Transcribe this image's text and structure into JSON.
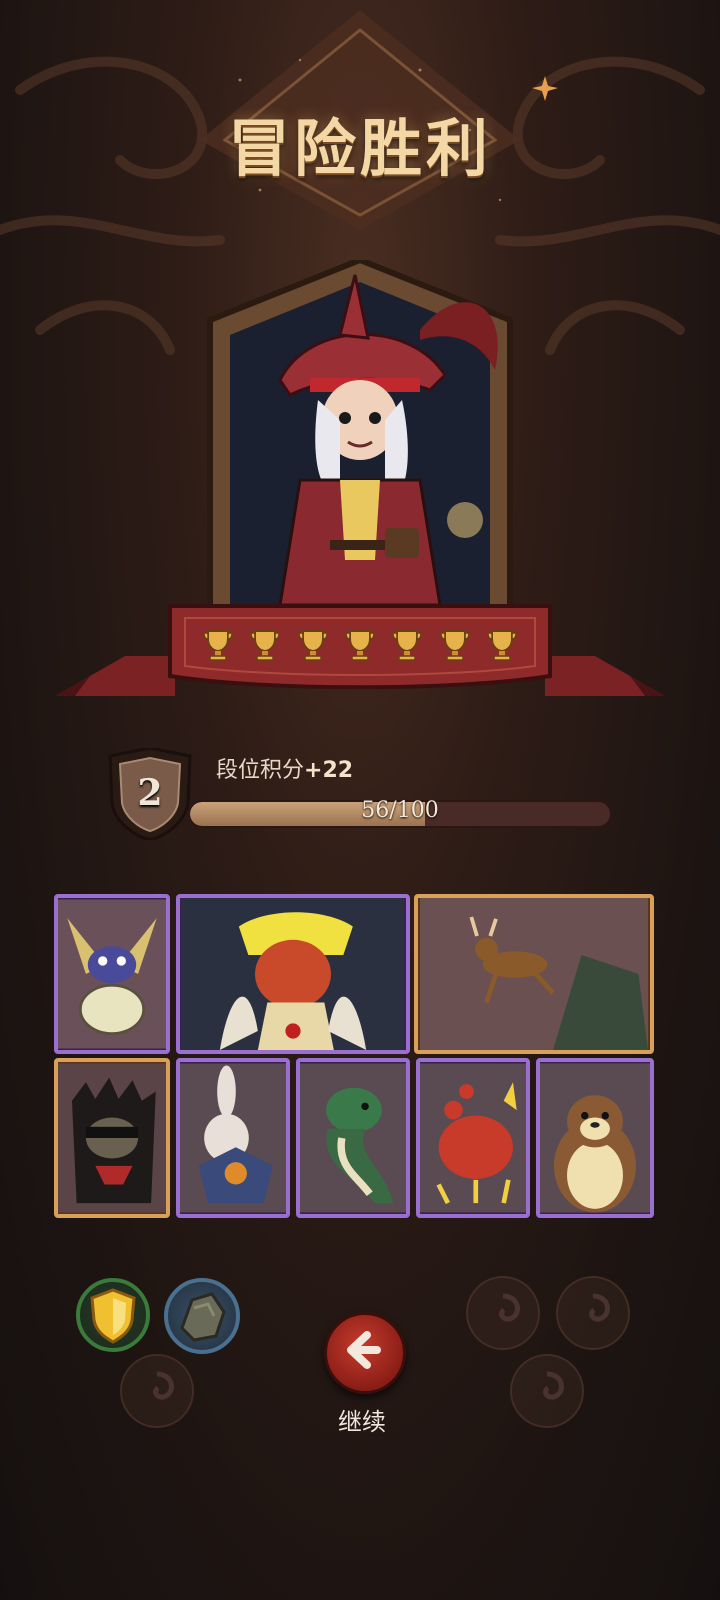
{
  "result": {
    "title": "冒险胜利"
  },
  "hero": {
    "icon": "pirate-hero-portrait",
    "trophies": [
      "trophy-icon",
      "trophy-icon",
      "trophy-icon",
      "trophy-icon",
      "trophy-icon",
      "trophy-icon",
      "trophy-icon"
    ]
  },
  "rank": {
    "level": "2",
    "label": "段位积分",
    "gain": "+22",
    "progress_text": "56/100",
    "progress_value": 56,
    "progress_max": 100
  },
  "cards_row1": [
    {
      "icon": "beetle-bug-card",
      "rarity": "purple"
    },
    {
      "icon": "dragon-king-card",
      "rarity": "purple"
    },
    {
      "icon": "deer-leap-card",
      "rarity": "gold"
    }
  ],
  "cards_row2": [
    {
      "icon": "hedgehog-bandit-card",
      "rarity": "gold"
    },
    {
      "icon": "scarecrow-rabbit-card",
      "rarity": "purple"
    },
    {
      "icon": "snake-card",
      "rarity": "purple"
    },
    {
      "icon": "crab-card",
      "rarity": "purple"
    },
    {
      "icon": "otter-card",
      "rarity": "purple"
    }
  ],
  "relics": [
    {
      "icon": "gold-shield-icon",
      "active": true
    },
    {
      "icon": "stone-relic-icon",
      "active": true
    },
    {
      "icon": "empty-relic-slot-icon",
      "active": false
    },
    {
      "icon": "empty-relic-slot-icon",
      "active": false
    },
    {
      "icon": "empty-relic-slot-icon",
      "active": false
    },
    {
      "icon": "empty-relic-slot-icon",
      "active": false
    }
  ],
  "actions": {
    "continue_label": "继续",
    "continue_icon": "arrow-left-icon"
  },
  "colors": {
    "gold": "#f3d7a4",
    "purple_frame": "#9a6fd0",
    "gold_frame": "#d9a05a",
    "continue_red": "#c63b2c"
  }
}
